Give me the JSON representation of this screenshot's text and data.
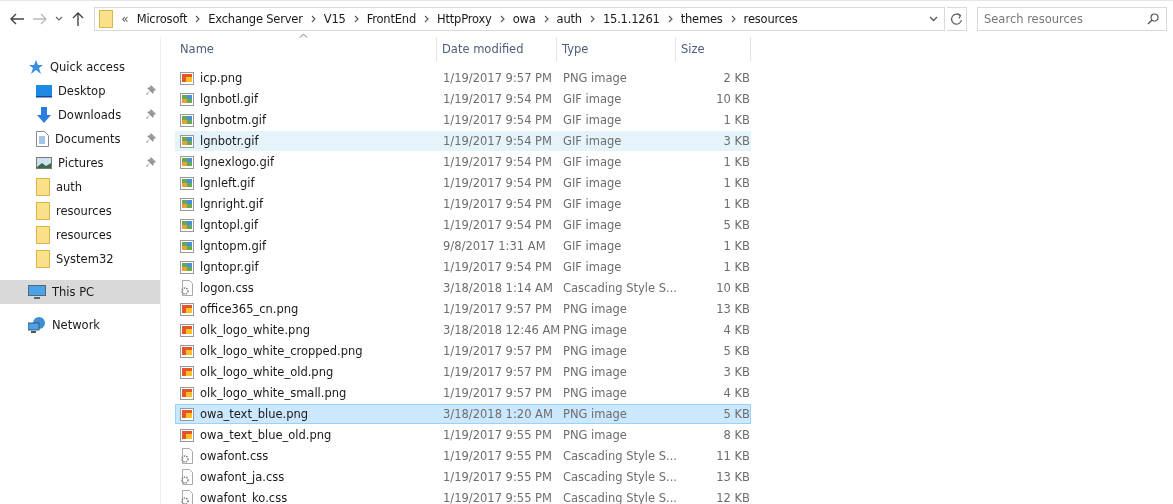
{
  "address": {
    "overflow": "«",
    "crumbs": [
      "Microsoft",
      "Exchange Server",
      "V15",
      "FrontEnd",
      "HttpProxy",
      "owa",
      "auth",
      "15.1.1261",
      "themes",
      "resources"
    ]
  },
  "search": {
    "placeholder": "Search resources"
  },
  "sidebar": {
    "items": [
      {
        "label": "Quick access",
        "pinned": false,
        "selected": false
      },
      {
        "label": "Desktop",
        "pinned": true,
        "selected": false
      },
      {
        "label": "Downloads",
        "pinned": true,
        "selected": false
      },
      {
        "label": "Documents",
        "pinned": true,
        "selected": false
      },
      {
        "label": "Pictures",
        "pinned": true,
        "selected": false
      },
      {
        "label": "auth",
        "pinned": false,
        "selected": false
      },
      {
        "label": "resources",
        "pinned": false,
        "selected": false
      },
      {
        "label": "resources",
        "pinned": false,
        "selected": false
      },
      {
        "label": "System32",
        "pinned": false,
        "selected": false
      },
      {
        "label": "This PC",
        "pinned": false,
        "selected": true
      },
      {
        "label": "Network",
        "pinned": false,
        "selected": false
      }
    ]
  },
  "table": {
    "columns": [
      "Name",
      "Date modified",
      "Type",
      "Size"
    ],
    "rows": [
      {
        "name": "icp.png",
        "date": "1/19/2017 9:57 PM",
        "type": "PNG image",
        "size": "2 KB",
        "kind": "png",
        "hovered": false,
        "selected": false
      },
      {
        "name": "lgnbotl.gif",
        "date": "1/19/2017 9:54 PM",
        "type": "GIF image",
        "size": "10 KB",
        "kind": "gif",
        "hovered": false,
        "selected": false
      },
      {
        "name": "lgnbotm.gif",
        "date": "1/19/2017 9:54 PM",
        "type": "GIF image",
        "size": "1 KB",
        "kind": "gif",
        "hovered": false,
        "selected": false
      },
      {
        "name": "lgnbotr.gif",
        "date": "1/19/2017 9:54 PM",
        "type": "GIF image",
        "size": "3 KB",
        "kind": "gif",
        "hovered": true,
        "selected": false
      },
      {
        "name": "lgnexlogo.gif",
        "date": "1/19/2017 9:54 PM",
        "type": "GIF image",
        "size": "1 KB",
        "kind": "gif",
        "hovered": false,
        "selected": false
      },
      {
        "name": "lgnleft.gif",
        "date": "1/19/2017 9:54 PM",
        "type": "GIF image",
        "size": "1 KB",
        "kind": "gif",
        "hovered": false,
        "selected": false
      },
      {
        "name": "lgnright.gif",
        "date": "1/19/2017 9:54 PM",
        "type": "GIF image",
        "size": "1 KB",
        "kind": "gif",
        "hovered": false,
        "selected": false
      },
      {
        "name": "lgntopl.gif",
        "date": "1/19/2017 9:54 PM",
        "type": "GIF image",
        "size": "5 KB",
        "kind": "gif",
        "hovered": false,
        "selected": false
      },
      {
        "name": "lgntopm.gif",
        "date": "9/8/2017 1:31 AM",
        "type": "GIF image",
        "size": "1 KB",
        "kind": "gif",
        "hovered": false,
        "selected": false
      },
      {
        "name": "lgntopr.gif",
        "date": "1/19/2017 9:54 PM",
        "type": "GIF image",
        "size": "1 KB",
        "kind": "gif",
        "hovered": false,
        "selected": false
      },
      {
        "name": "logon.css",
        "date": "3/18/2018 1:14 AM",
        "type": "Cascading Style S...",
        "size": "10 KB",
        "kind": "css",
        "hovered": false,
        "selected": false
      },
      {
        "name": "office365_cn.png",
        "date": "1/19/2017 9:57 PM",
        "type": "PNG image",
        "size": "13 KB",
        "kind": "png",
        "hovered": false,
        "selected": false
      },
      {
        "name": "olk_logo_white.png",
        "date": "3/18/2018 12:46 AM",
        "type": "PNG image",
        "size": "4 KB",
        "kind": "png",
        "hovered": false,
        "selected": false
      },
      {
        "name": "olk_logo_white_cropped.png",
        "date": "1/19/2017 9:57 PM",
        "type": "PNG image",
        "size": "5 KB",
        "kind": "png",
        "hovered": false,
        "selected": false
      },
      {
        "name": "olk_logo_white_old.png",
        "date": "1/19/2017 9:57 PM",
        "type": "PNG image",
        "size": "3 KB",
        "kind": "png",
        "hovered": false,
        "selected": false
      },
      {
        "name": "olk_logo_white_small.png",
        "date": "1/19/2017 9:57 PM",
        "type": "PNG image",
        "size": "4 KB",
        "kind": "png",
        "hovered": false,
        "selected": false
      },
      {
        "name": "owa_text_blue.png",
        "date": "3/18/2018 1:20 AM",
        "type": "PNG image",
        "size": "5 KB",
        "kind": "png",
        "hovered": false,
        "selected": true
      },
      {
        "name": "owa_text_blue_old.png",
        "date": "1/19/2017 9:55 PM",
        "type": "PNG image",
        "size": "8 KB",
        "kind": "png",
        "hovered": false,
        "selected": false
      },
      {
        "name": "owafont.css",
        "date": "1/19/2017 9:55 PM",
        "type": "Cascading Style S...",
        "size": "11 KB",
        "kind": "css",
        "hovered": false,
        "selected": false
      },
      {
        "name": "owafont_ja.css",
        "date": "1/19/2017 9:55 PM",
        "type": "Cascading Style S...",
        "size": "13 KB",
        "kind": "css",
        "hovered": false,
        "selected": false
      },
      {
        "name": "owafont_ko.css",
        "date": "1/19/2017 9:55 PM",
        "type": "Cascading Style S...",
        "size": "12 KB",
        "kind": "css",
        "hovered": false,
        "selected": false
      }
    ]
  }
}
